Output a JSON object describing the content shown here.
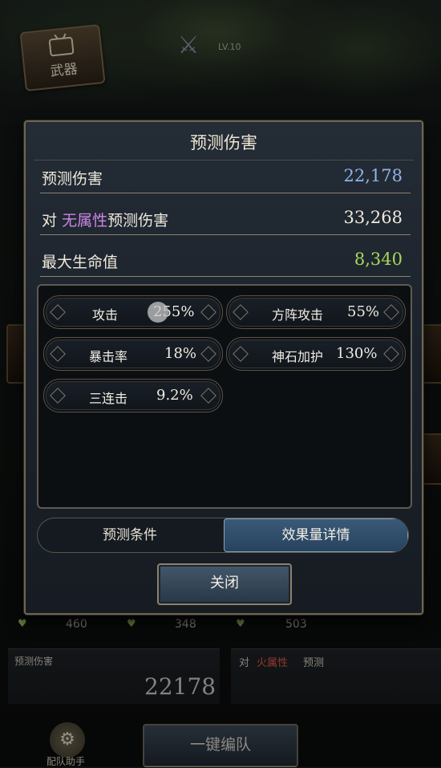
{
  "background": {
    "weapon_button_label": "武器",
    "level_text": "LV.10"
  },
  "modal": {
    "title": "预测伤害",
    "rows": [
      {
        "label": "预测伤害",
        "value": "22,178",
        "value_color": "#8fb4e8"
      },
      {
        "label_prefix": "对",
        "label_highlight": "无属性",
        "label_suffix": "预测伤害",
        "value": "33,268",
        "value_color": "#efe9dc"
      },
      {
        "label": "最大生命值",
        "value": "8,340",
        "value_color": "#a6d85a"
      }
    ],
    "effects": [
      {
        "label": "攻击",
        "value": "255%"
      },
      {
        "label": "方阵攻击",
        "value": "55%"
      },
      {
        "label": "暴击率",
        "value": "18%"
      },
      {
        "label": "神石加护",
        "value": "130%"
      },
      {
        "label": "三连击",
        "value": "9.2%"
      }
    ],
    "tabs": {
      "left": "预测条件",
      "right": "效果量详情",
      "active": "right"
    },
    "close_label": "关闭"
  },
  "bottom": {
    "hp_values": [
      "460",
      "348",
      "503"
    ],
    "left_panel_label": "预测伤害",
    "left_panel_value": "22178",
    "right_panel_prefix": "对",
    "right_panel_highlight": "火属性",
    "right_panel_suffix": "预测",
    "team_button_label": "一键编队",
    "assist_label": "配队助手"
  },
  "colors": {
    "highlight_purple": "#cc86e6",
    "highlight_red": "#e05848",
    "accent_blue": "#8fb4e8",
    "accent_green": "#a6d85a"
  }
}
